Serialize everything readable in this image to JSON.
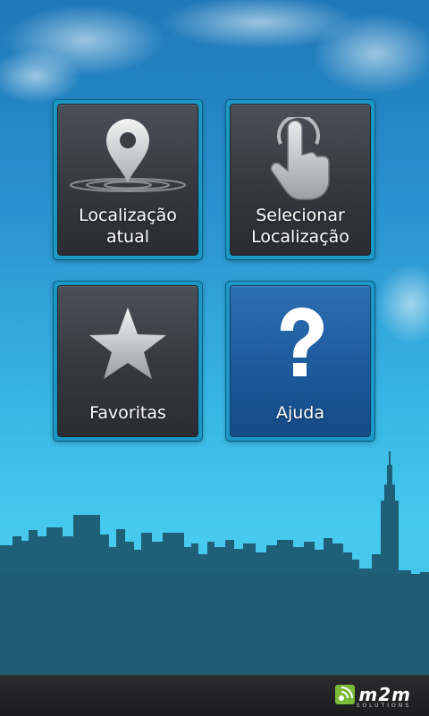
{
  "menu": {
    "items": [
      {
        "label_line1": "Localização",
        "label_line2": "atual",
        "icon": "location-pin-icon"
      },
      {
        "label_line1": "Selecionar",
        "label_line2": "Localização",
        "icon": "touch-hand-icon"
      },
      {
        "label": "Favoritas",
        "icon": "star-icon"
      },
      {
        "label": "Ajuda",
        "icon": "help-question-icon"
      }
    ]
  },
  "footer": {
    "brand_name": "m2m",
    "brand_tagline": "SOLUTIONS"
  },
  "colors": {
    "tile_dark": "#35383e",
    "tile_blue": "#1d5a9c",
    "brand_green": "#7ab93a",
    "skyline": "#1f5f78"
  }
}
